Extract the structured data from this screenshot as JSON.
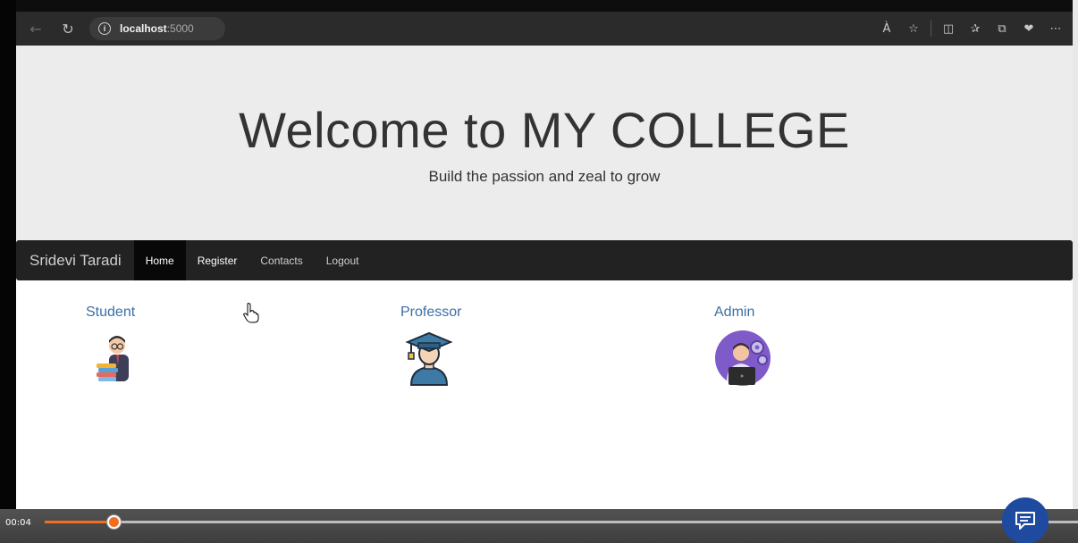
{
  "browser": {
    "url_host": "localhost",
    "url_port": ":5000",
    "info_icon": "info-icon",
    "back_icon": "back-arrow-icon",
    "refresh_icon": "refresh-icon",
    "tools": [
      "read-aloud-icon",
      "favorite-star-icon",
      "split-screen-icon",
      "favorites-list-icon",
      "collections-icon",
      "extensions-icon",
      "more-options-icon"
    ],
    "tool_glyphs": [
      "À",
      "☆",
      "◫",
      "✰",
      "⧉",
      "❤",
      "⋯"
    ]
  },
  "jumbotron": {
    "title": "Welcome to MY COLLEGE",
    "subtitle": "Build the passion and zeal to grow"
  },
  "navbar": {
    "brand": "Sridevi Taradi",
    "items": [
      {
        "label": "Home",
        "state": "active"
      },
      {
        "label": "Register",
        "state": "hover"
      },
      {
        "label": "Contacts",
        "state": "normal"
      },
      {
        "label": "Logout",
        "state": "normal"
      }
    ]
  },
  "cards": [
    {
      "title": "Student",
      "icon": "student-avatar-icon"
    },
    {
      "title": "Professor",
      "icon": "graduate-avatar-icon"
    },
    {
      "title": "Admin",
      "icon": "admin-avatar-icon"
    }
  ],
  "player": {
    "time": "00:04",
    "progress_fraction": 0.067,
    "accent": "#f36d21",
    "chat_icon": "chat-bubble-icon",
    "chat_color": "#1e4aa0"
  },
  "colors": {
    "navbar_bg": "#222222",
    "jumbotron_bg": "#ececec",
    "card_title": "#3a6fa8"
  }
}
